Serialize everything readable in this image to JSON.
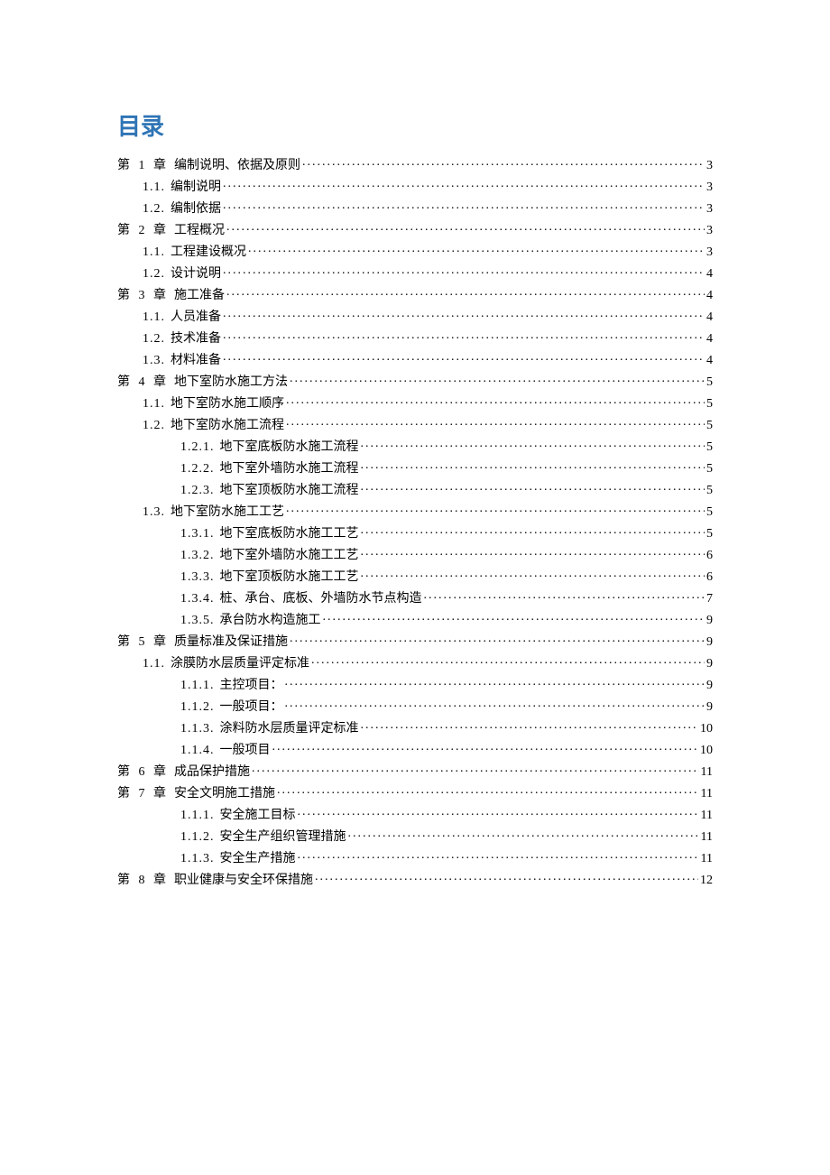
{
  "heading": "目录",
  "entries": [
    {
      "level": 0,
      "label": "第 1 章",
      "chapter": true,
      "title": "编制说明、依据及原则",
      "page": "3"
    },
    {
      "level": 1,
      "label": "1.1.",
      "title": "编制说明",
      "page": "3"
    },
    {
      "level": 1,
      "label": "1.2.",
      "title": "编制依据",
      "page": "3"
    },
    {
      "level": 0,
      "label": "第 2 章",
      "chapter": true,
      "title": "工程概况",
      "page": "3"
    },
    {
      "level": 1,
      "label": "1.1.",
      "title": "工程建设概况",
      "page": "3"
    },
    {
      "level": 1,
      "label": "1.2.",
      "title": "设计说明",
      "page": "4"
    },
    {
      "level": 0,
      "label": "第 3 章",
      "chapter": true,
      "title": "施工准备",
      "page": "4"
    },
    {
      "level": 1,
      "label": "1.1.",
      "title": "人员准备",
      "page": "4"
    },
    {
      "level": 1,
      "label": "1.2.",
      "title": "技术准备",
      "page": "4"
    },
    {
      "level": 1,
      "label": "1.3.",
      "title": "材料准备",
      "page": "4"
    },
    {
      "level": 0,
      "label": "第 4 章",
      "chapter": true,
      "title": "地下室防水施工方法",
      "page": "5"
    },
    {
      "level": 1,
      "label": "1.1.",
      "title": "地下室防水施工顺序",
      "page": "5"
    },
    {
      "level": 1,
      "label": "1.2.",
      "title": "地下室防水施工流程",
      "page": "5"
    },
    {
      "level": 2,
      "label": "1.2.1.",
      "title": "地下室底板防水施工流程",
      "page": "5"
    },
    {
      "level": 2,
      "label": "1.2.2.",
      "title": "地下室外墙防水施工流程",
      "page": "5"
    },
    {
      "level": 2,
      "label": "1.2.3.",
      "title": "地下室顶板防水施工流程",
      "page": "5"
    },
    {
      "level": 1,
      "label": "1.3.",
      "title": "地下室防水施工工艺",
      "page": "5"
    },
    {
      "level": 2,
      "label": "1.3.1.",
      "title": "地下室底板防水施工工艺",
      "page": "5"
    },
    {
      "level": 2,
      "label": "1.3.2.",
      "title": "地下室外墙防水施工工艺",
      "page": "6"
    },
    {
      "level": 2,
      "label": "1.3.3.",
      "title": "地下室顶板防水施工工艺",
      "page": "6"
    },
    {
      "level": 2,
      "label": "1.3.4.",
      "title": "桩、承台、底板、外墙防水节点构造",
      "page": "7"
    },
    {
      "level": 2,
      "label": "1.3.5.",
      "title": "承台防水构造施工",
      "page": "9"
    },
    {
      "level": 0,
      "label": "第 5 章",
      "chapter": true,
      "title": "质量标准及保证措施",
      "page": "9"
    },
    {
      "level": 1,
      "label": "1.1.",
      "title": "涂膜防水层质量评定标准",
      "page": "9"
    },
    {
      "level": 2,
      "label": "1.1.1.",
      "title": "主控项目：",
      "page": "9"
    },
    {
      "level": 2,
      "label": "1.1.2.",
      "title": "一般项目：",
      "page": "9"
    },
    {
      "level": 2,
      "label": "1.1.3.",
      "title": "涂料防水层质量评定标准",
      "page": "10"
    },
    {
      "level": 2,
      "label": "1.1.4.",
      "title": "一般项目",
      "page": "10"
    },
    {
      "level": 0,
      "label": "第 6 章",
      "chapter": true,
      "title": "成品保护措施",
      "page": "11"
    },
    {
      "level": 0,
      "label": "第 7 章",
      "chapter": true,
      "title": "安全文明施工措施",
      "page": "11"
    },
    {
      "level": 2,
      "label": "1.1.1.",
      "title": "安全施工目标",
      "page": "11"
    },
    {
      "level": 2,
      "label": "1.1.2.",
      "title": "安全生产组织管理措施",
      "page": "11"
    },
    {
      "level": 2,
      "label": "1.1.3.",
      "title": "安全生产措施",
      "page": "11"
    },
    {
      "level": 0,
      "label": "第 8 章",
      "chapter": true,
      "title": "职业健康与安全环保措施",
      "page": "12"
    }
  ]
}
